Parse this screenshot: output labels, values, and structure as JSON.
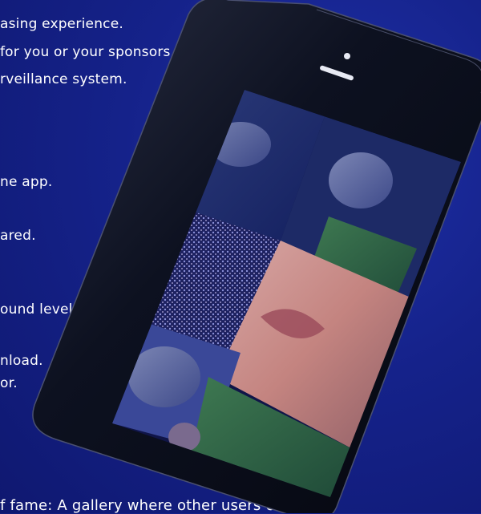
{
  "copy": {
    "lines": [
      "asing experience.",
      "for you or your sponsors.",
      "rveillance system.",
      "ne app.",
      "ared.",
      "ound levels.",
      "nload.",
      "or.",
      "f fame: A gallery where other users can"
    ]
  },
  "phone": {
    "device": "smartphone",
    "icons": [
      "speaker-icon",
      "camera-icon"
    ]
  },
  "colors": {
    "background": "#15228a",
    "text": "#ffffff",
    "phone_body": "#0d1120"
  }
}
